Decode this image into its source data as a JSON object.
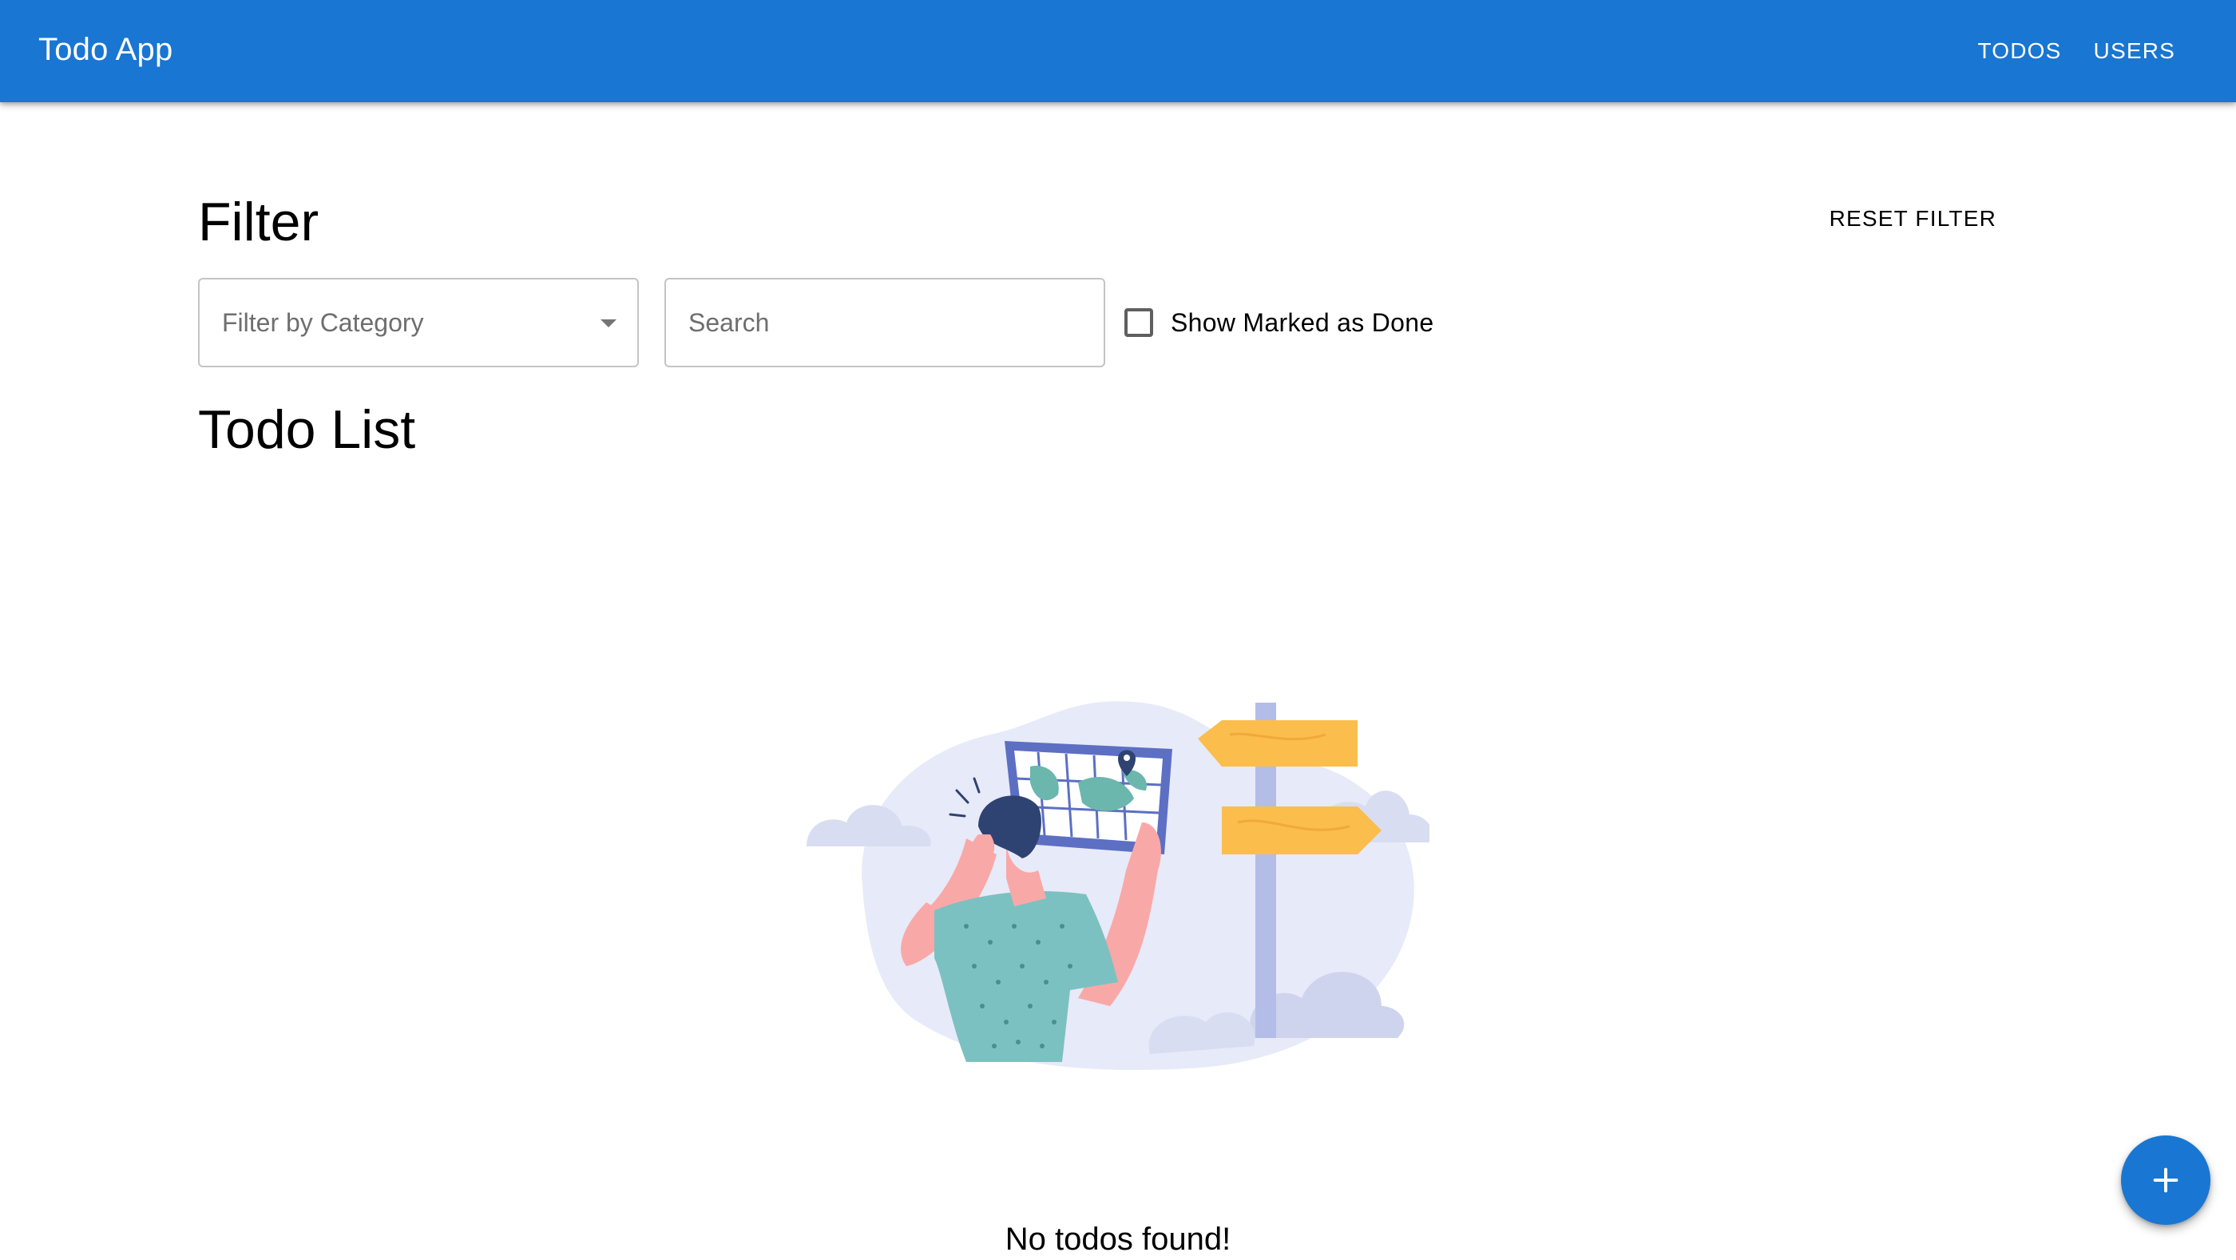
{
  "app": {
    "title": "Todo App"
  },
  "nav": {
    "items": [
      {
        "label": "TODOS"
      },
      {
        "label": "USERS"
      }
    ]
  },
  "filter": {
    "heading": "Filter",
    "reset_label": "RESET FILTER",
    "category": {
      "placeholder": "Filter by Category"
    },
    "search": {
      "placeholder": "Search",
      "value": ""
    },
    "show_done": {
      "label": "Show Marked as Done",
      "checked": false
    }
  },
  "todo_list": {
    "heading": "Todo List",
    "empty_message": "No todos found!"
  },
  "fab": {
    "icon": "plus-icon"
  },
  "colors": {
    "primary": "#1976d2",
    "on_primary": "#ffffff",
    "illustration_sign": "#fbbd4b",
    "illustration_shirt": "#7cc1c1",
    "illustration_blob": "#e7eaf8",
    "illustration_hair": "#2f4372"
  }
}
